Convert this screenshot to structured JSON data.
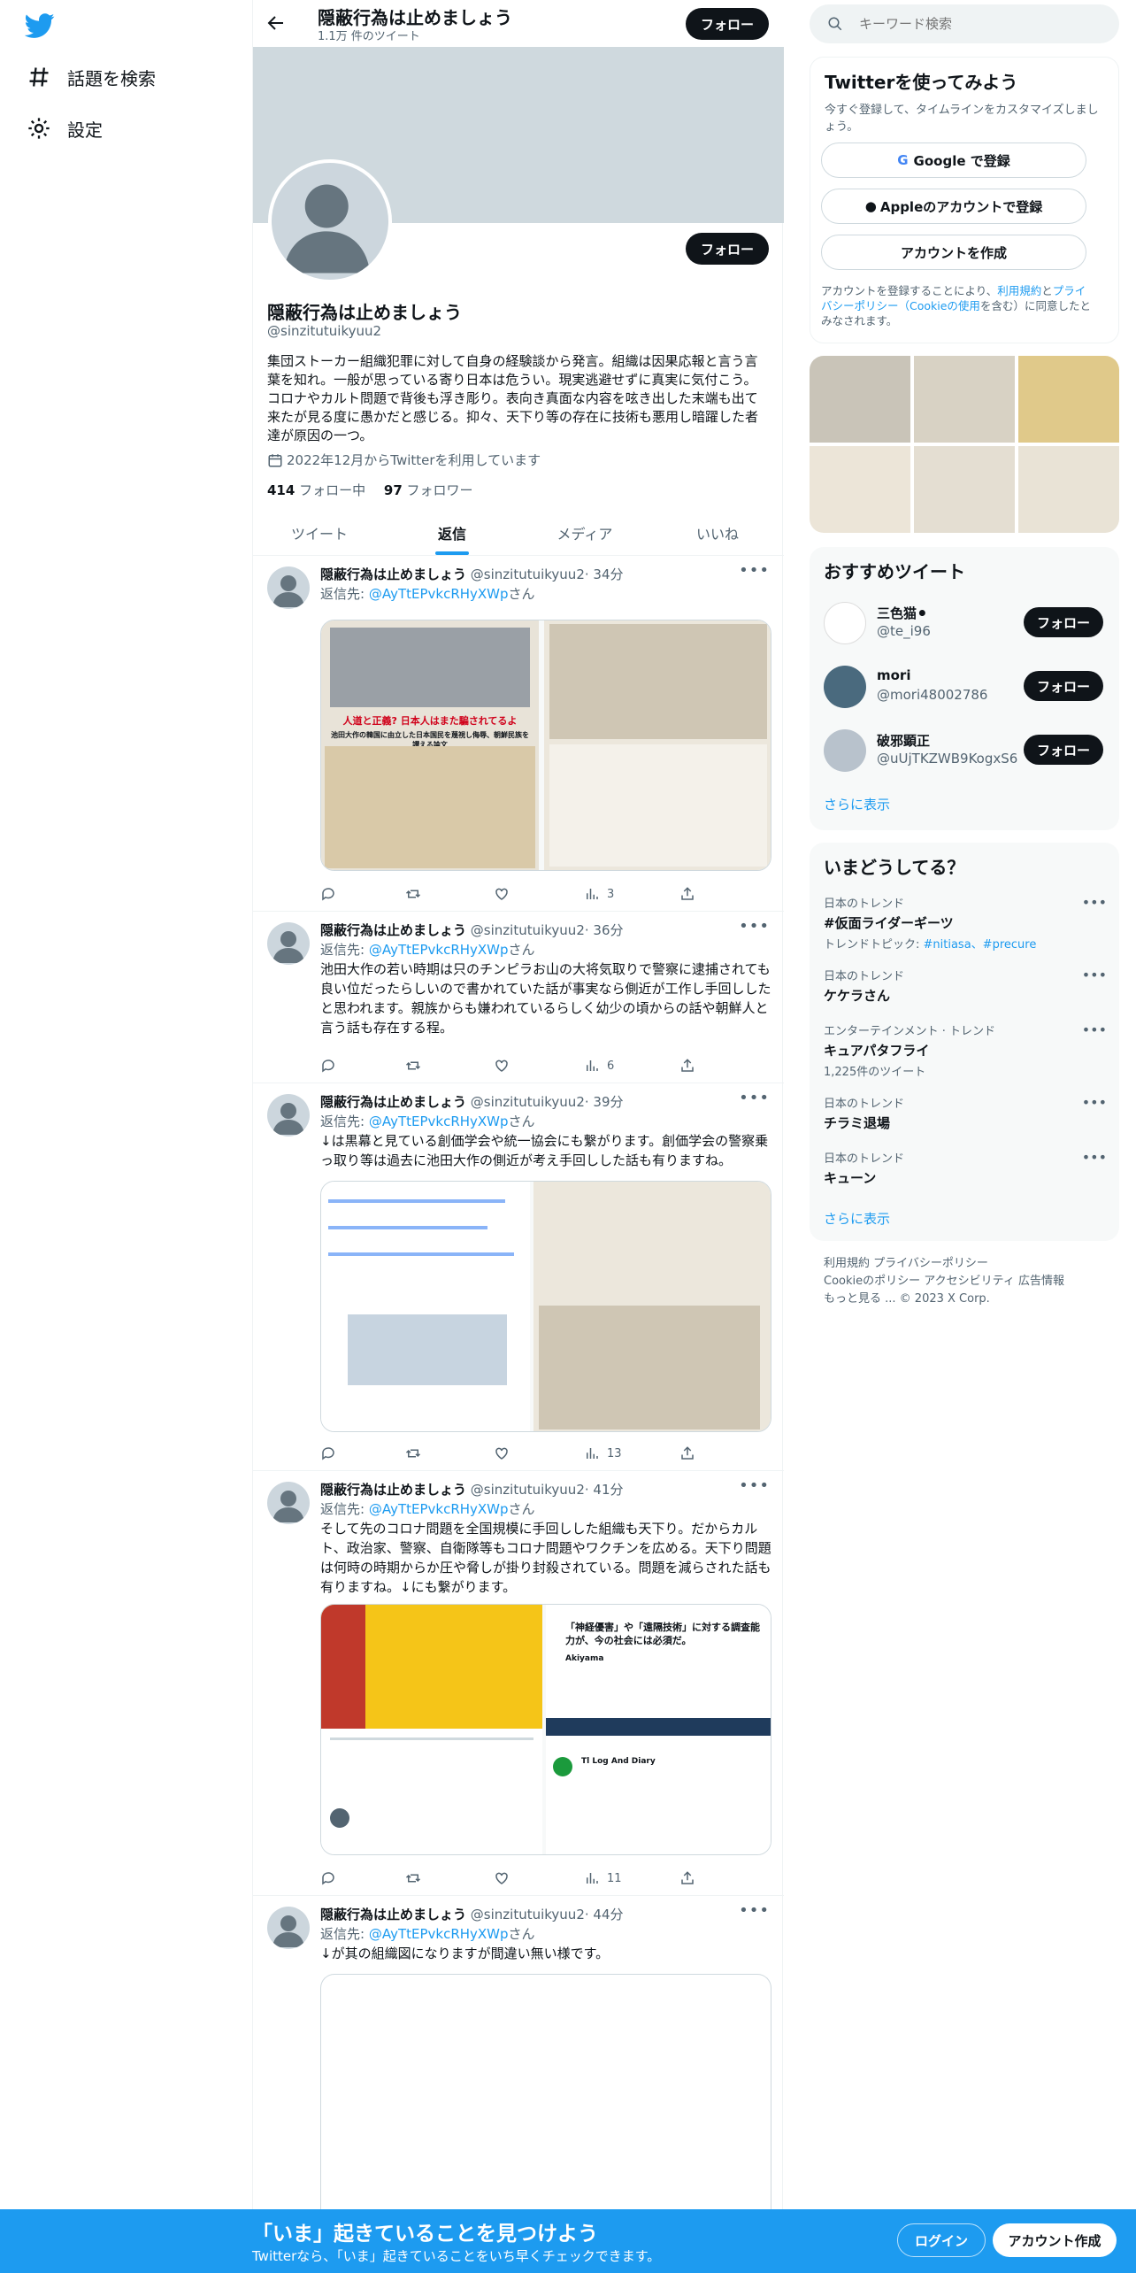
{
  "nav": {
    "explore": "話題を検索",
    "settings": "設定"
  },
  "header": {
    "title": "隠蔽行為は止めましょう",
    "tweet_count": "1.1万 件のツイート",
    "follow": "フォロー"
  },
  "profile": {
    "name": "隠蔽行為は止めましょう",
    "handle": "@sinzitutuikyuu2",
    "follow": "フォロー",
    "bio": "集団ストーカー組織犯罪に対して自身の経験談から発言。組織は因果応報と言う言葉を知れ。一般が思っている寄り日本は危うい。現実逃避せずに真実に気付こう。コロナやカルト問題で背後も浮き彫り。表向き真面な内容を呟き出した末端も出て来たが見る度に愚かだと感じる。抑々、天下り等の存在に技術も悪用し暗躍した者達が原因の一つ。",
    "joined": "2022年12月からTwitterを利用しています",
    "following_count": "414",
    "following_label": "フォロー中",
    "followers_count": "97",
    "followers_label": "フォロワー"
  },
  "tabs": [
    "ツイート",
    "返信",
    "メディア",
    "いいね"
  ],
  "tweets": [
    {
      "name": "隠蔽行為は止めましょう",
      "handle": "@sinzitutuikyuu2",
      "time": "· 34分",
      "reply_prefix": "返信先: ",
      "reply_to": "@AyTtEPvkcRHyXWp",
      "reply_suffix": "さん",
      "text": "",
      "views": "3",
      "media_caption": "人道と正義? 日本人はまた騙されてるよ",
      "media_caption2": "池田大作の韓国に由立した日本国民を蔑視し侮辱、朝鮮民族を讃える論文"
    },
    {
      "name": "隠蔽行為は止めましょう",
      "handle": "@sinzitutuikyuu2",
      "time": "· 36分",
      "reply_prefix": "返信先: ",
      "reply_to": "@AyTtEPvkcRHyXWp",
      "reply_suffix": "さん",
      "text": "池田大作の若い時期は只のチンピラお山の大将気取りで警察に逮捕されても良い位だったらしいので書かれていた話が事実なら側近が工作し手回ししたと思われます。親族からも嫌われているらしく幼少の頃からの話や朝鮮人と言う話も存在する程。",
      "views": "6"
    },
    {
      "name": "隠蔽行為は止めましょう",
      "handle": "@sinzitutuikyuu2",
      "time": "· 39分",
      "reply_prefix": "返信先: ",
      "reply_to": "@AyTtEPvkcRHyXWp",
      "reply_suffix": "さん",
      "text": "↓は黒幕と見ている創価学会や統一協会にも繋がります。創価学会の警察乗っ取り等は過去に池田大作の側近が考え手回しした話も有りますね。",
      "views": "13"
    },
    {
      "name": "隠蔽行為は止めましょう",
      "handle": "@sinzitutuikyuu2",
      "time": "· 41分",
      "reply_prefix": "返信先: ",
      "reply_to": "@AyTtEPvkcRHyXWp",
      "reply_suffix": "さん",
      "text": "そして先のコロナ問題を全国規模に手回しした組織も天下り。だからカルト、政治家、警察、自衛隊等もコロナ問題やワクチンを広める。天下り問題は何時の時期からか圧や脅しが掛り封殺されている。問題を減らされた話も有りますね。↓にも繋がります。",
      "views": "11",
      "media_heading": "「神経優害」や「遠隔技術」に対する調査能力が、今の社会には必須だ。",
      "media_user": "Akiyama",
      "media_user2": "Tl Log And Diary"
    },
    {
      "name": "隠蔽行為は止めましょう",
      "handle": "@sinzitutuikyuu2",
      "time": "· 44分",
      "reply_prefix": "返信先: ",
      "reply_to": "@AyTtEPvkcRHyXWp",
      "reply_suffix": "さん",
      "text": "↓が其の組織図になりますが間違い無い様です。"
    }
  ],
  "search": {
    "placeholder": "キーワード検索"
  },
  "signup": {
    "title": "Twitterを使ってみよう",
    "subtitle": "今すぐ登録して、タイムラインをカスタマイズしましょう。",
    "google": "Google で登録",
    "apple": "Appleのアカウントで登録",
    "create": "アカウントを作成",
    "terms_1": "アカウントを登録することにより、",
    "terms_link1": "利用規約",
    "terms_2": "と",
    "terms_link2": "プライバシーポリシー（Cookieの使用",
    "terms_3": "を含む）に同意したとみなされます。"
  },
  "recommended": {
    "title": "おすすめツイート",
    "users": [
      {
        "name": "三色猫⚫",
        "handle": "@te_i96",
        "follow": "フォロー"
      },
      {
        "name": "mori",
        "handle": "@mori48002786",
        "follow": "フォロー"
      },
      {
        "name": "破邪顕正",
        "handle": "@uUjTKZWB9KogxS6",
        "follow": "フォロー"
      }
    ],
    "more": "さらに表示"
  },
  "trends": {
    "title": "いまどうしてる？",
    "items": [
      {
        "category": "日本のトレンド",
        "name": "#仮面ライダーギーツ",
        "sub_prefix": "トレンドトピック: ",
        "sub_links": "#nitiasa、#precure"
      },
      {
        "category": "日本のトレンド",
        "name": "ケケラさん"
      },
      {
        "category": "エンターテインメント · トレンド",
        "name": "キュアパタフライ",
        "sub": "1,225件のツイート"
      },
      {
        "category": "日本のトレンド",
        "name": "チラミ退場"
      },
      {
        "category": "日本のトレンド",
        "name": "キューン"
      }
    ],
    "more": "さらに表示"
  },
  "footer": {
    "links_line1": "利用規約   プライバシーポリシー",
    "links_line2": "Cookieのポリシー   アクセシビリティ   広告情報",
    "links_line3": "もっと見る ...   © 2023 X Corp."
  },
  "bottom": {
    "title": "「いま」起きていることを見つけよう",
    "subtitle": "Twitterなら、「いま」起きていることをいち早くチェックできます。",
    "login": "ログイン",
    "signup": "アカウント作成"
  },
  "colors": {
    "accent": "#1d9bf0",
    "text": "#0f1419",
    "muted": "#536471"
  }
}
